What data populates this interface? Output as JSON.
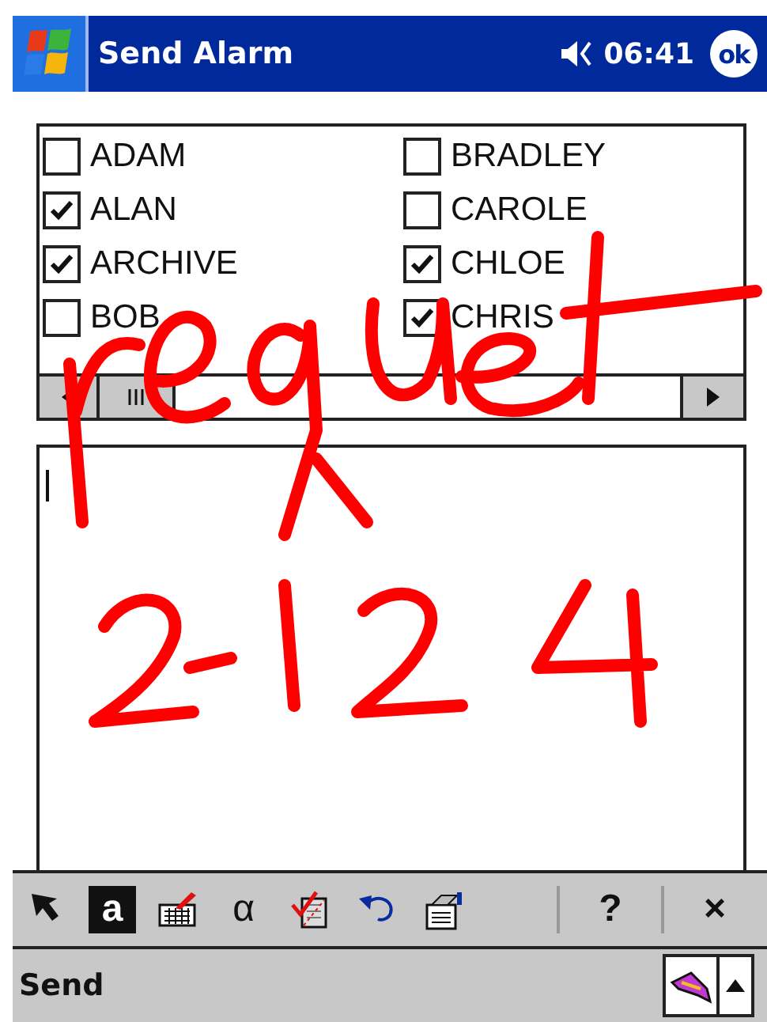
{
  "title_bar": {
    "title": "Send Alarm",
    "time": "06:41",
    "ok": "ok"
  },
  "contacts": [
    {
      "name": "ADAM",
      "checked": false
    },
    {
      "name": "ALAN",
      "checked": true
    },
    {
      "name": "ARCHIVE",
      "checked": true
    },
    {
      "name": "BOB",
      "checked": false
    },
    {
      "name": "BRADLEY",
      "checked": false
    },
    {
      "name": "CAROLE",
      "checked": false
    },
    {
      "name": "CHLOE",
      "checked": true
    },
    {
      "name": "CHRIS",
      "checked": true
    }
  ],
  "toolbar": [
    {
      "kind": "arrow",
      "selected": false
    },
    {
      "kind": "glyph",
      "text": "a",
      "selected": true
    },
    {
      "kind": "keyboard",
      "selected": false
    },
    {
      "kind": "glyph",
      "text": "α",
      "selected": false
    },
    {
      "kind": "spellcheck",
      "selected": false
    },
    {
      "kind": "undo",
      "selected": false
    },
    {
      "kind": "properties",
      "selected": false
    },
    {
      "kind": "separator"
    },
    {
      "kind": "glyph",
      "text": "?",
      "selected": false
    },
    {
      "kind": "separator"
    },
    {
      "kind": "glyph",
      "text": "×",
      "selected": false
    }
  ],
  "menu_bar": {
    "command": "Send"
  }
}
